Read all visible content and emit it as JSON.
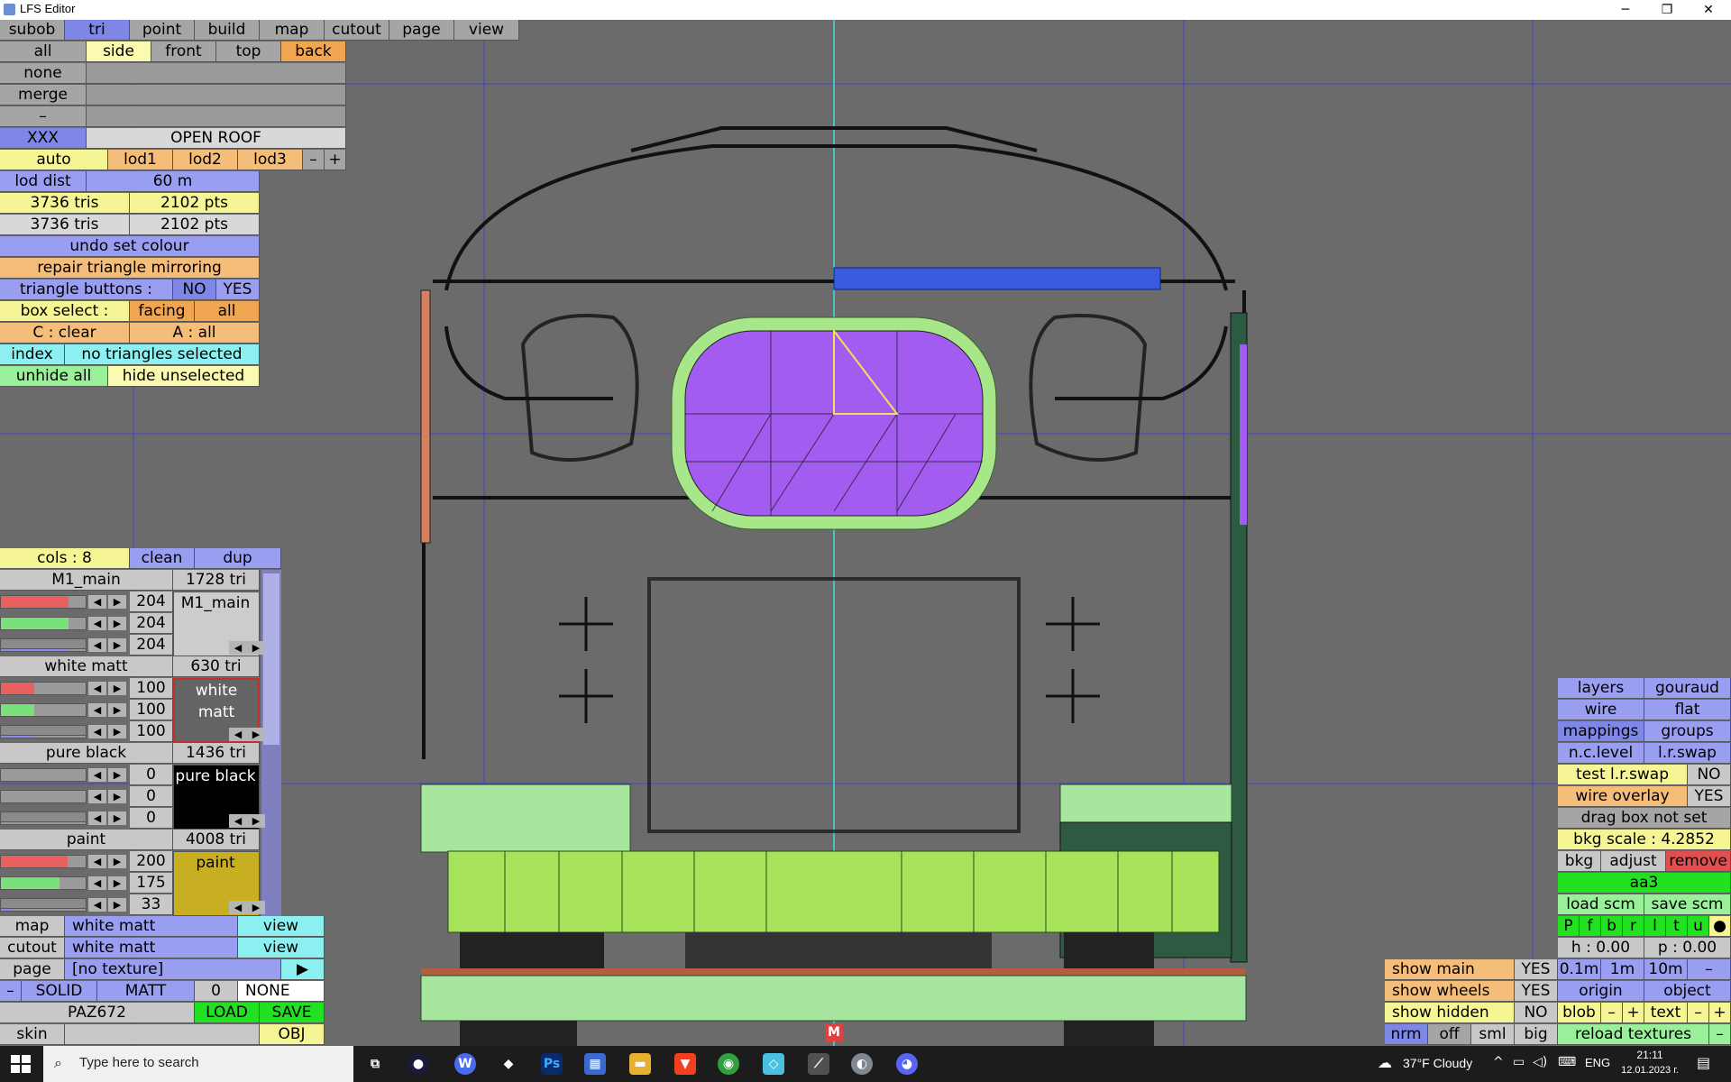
{
  "window": {
    "title": "LFS Editor"
  },
  "menu": {
    "tabs": [
      "subob",
      "tri",
      "point",
      "build",
      "map",
      "cutout",
      "page",
      "view"
    ]
  },
  "select_row": {
    "all": "all",
    "views": [
      "side",
      "front",
      "top",
      "back"
    ]
  },
  "left_labels": {
    "none": "none",
    "merge": "merge",
    "minus": "–"
  },
  "object_bar": {
    "xxx": "XXX",
    "name": "OPEN ROOF"
  },
  "lod": {
    "auto": "auto",
    "items": [
      "lod1",
      "lod2",
      "lod3"
    ],
    "minus": "–",
    "plus": "+"
  },
  "lod_dist": {
    "label": "lod dist",
    "value": "60 m"
  },
  "counts": [
    {
      "tris": "3736 tris",
      "pts": "2102 pts"
    },
    {
      "tris": "3736 tris",
      "pts": "2102 pts"
    }
  ],
  "actions": {
    "undo": "undo set colour",
    "repair": "repair triangle mirroring"
  },
  "triangle_buttons": {
    "label": "triangle buttons :",
    "no": "NO",
    "yes": "YES"
  },
  "box_select": {
    "label": "box select :",
    "facing": "facing",
    "all": "all"
  },
  "clear_all": {
    "clear": "C : clear",
    "all": "A : all"
  },
  "index": {
    "label": "index",
    "value": "no triangles selected"
  },
  "hide": {
    "unhide": "unhide all",
    "hide": "hide unselected"
  },
  "cols_bar": {
    "cols": "cols : 8",
    "clean": "clean",
    "dup": "dup"
  },
  "materials": [
    {
      "name": "M1_main",
      "tri": "1728 tri",
      "rgb": [
        "204",
        "204",
        "204"
      ],
      "label": "M1_main",
      "swatch": "#cccccc",
      "text_color": "#000000"
    },
    {
      "name": "white matt",
      "tri": "630 tri",
      "rgb": [
        "100",
        "100",
        "100"
      ],
      "label": "white matt",
      "swatch": "#646464",
      "text_color": "#ffffff"
    },
    {
      "name": "pure black",
      "tri": "1436 tri",
      "rgb": [
        "0",
        "0",
        "0"
      ],
      "label": "pure black",
      "swatch": "#000000",
      "text_color": "#ffffff"
    },
    {
      "name": "paint",
      "tri": "4008 tri",
      "rgb": [
        "200",
        "175",
        "33"
      ],
      "label": "paint",
      "swatch": "#c8af21",
      "text_color": "#000000"
    }
  ],
  "bottom_left": {
    "map": {
      "label": "map",
      "value": "white matt",
      "view": "view"
    },
    "cutout": {
      "label": "cutout",
      "value": "white matt",
      "view": "view"
    },
    "page": {
      "label": "page",
      "value": "[no texture]",
      "arrow": "▶"
    },
    "solid_row": {
      "minus": "–",
      "solid": "SOLID",
      "matt": "MATT",
      "num": "0",
      "none": "NONE"
    },
    "file": {
      "name": "PAZ672",
      "load": "LOAD",
      "save": "SAVE"
    },
    "skin": {
      "label": "skin",
      "obj": "OBJ"
    }
  },
  "right_panel": {
    "layers": "layers",
    "gouraud": "gouraud",
    "wire": "wire",
    "flat": "flat",
    "mappings": "mappings",
    "groups": "groups",
    "nclevel": "n.c.level",
    "lrswap": "l.r.swap",
    "test_lr": {
      "label": "test l.r.swap",
      "value": "NO"
    },
    "wire_overlay": {
      "label": "wire overlay",
      "value": "YES"
    },
    "drag_box": "drag box not set",
    "bkg_scale": "bkg scale : 4.2852",
    "bkg": "bkg",
    "adjust": "adjust",
    "remove": "remove",
    "aa3": "aa3",
    "load_scm": "load scm",
    "save_scm": "save scm",
    "flags": [
      "P",
      "f",
      "b",
      "r",
      "l",
      "t",
      "u",
      "●"
    ],
    "h": "h : 0.00",
    "p": "p : 0.00",
    "steps": [
      "0.1m",
      "1m",
      "10m",
      "–"
    ],
    "origin": "origin",
    "object": "object",
    "blob": "blob",
    "blob_minus": "–",
    "blob_plus": "+",
    "text": "text",
    "text_minus": "–",
    "text_plus": "+",
    "reload": "reload textures",
    "reload_minus": "–"
  },
  "show_panel": [
    {
      "label": "show main",
      "value": "YES"
    },
    {
      "label": "show wheels",
      "value": "YES"
    },
    {
      "label": "show hidden",
      "value": "NO"
    }
  ],
  "view_modes": [
    "nrm",
    "off",
    "sml",
    "big"
  ],
  "marker": "M",
  "taskbar": {
    "search": "Type here to search",
    "weather": "37°F  Cloudy",
    "lang": "ENG",
    "time": "21:11",
    "date": "12.01.2023 г."
  },
  "colors": {
    "accent": "#9a9ef0",
    "viewport": "#6b6b6b",
    "purple": "#a35cf0",
    "green": "#a6e35a",
    "lightgreen": "#a8e6a0"
  }
}
